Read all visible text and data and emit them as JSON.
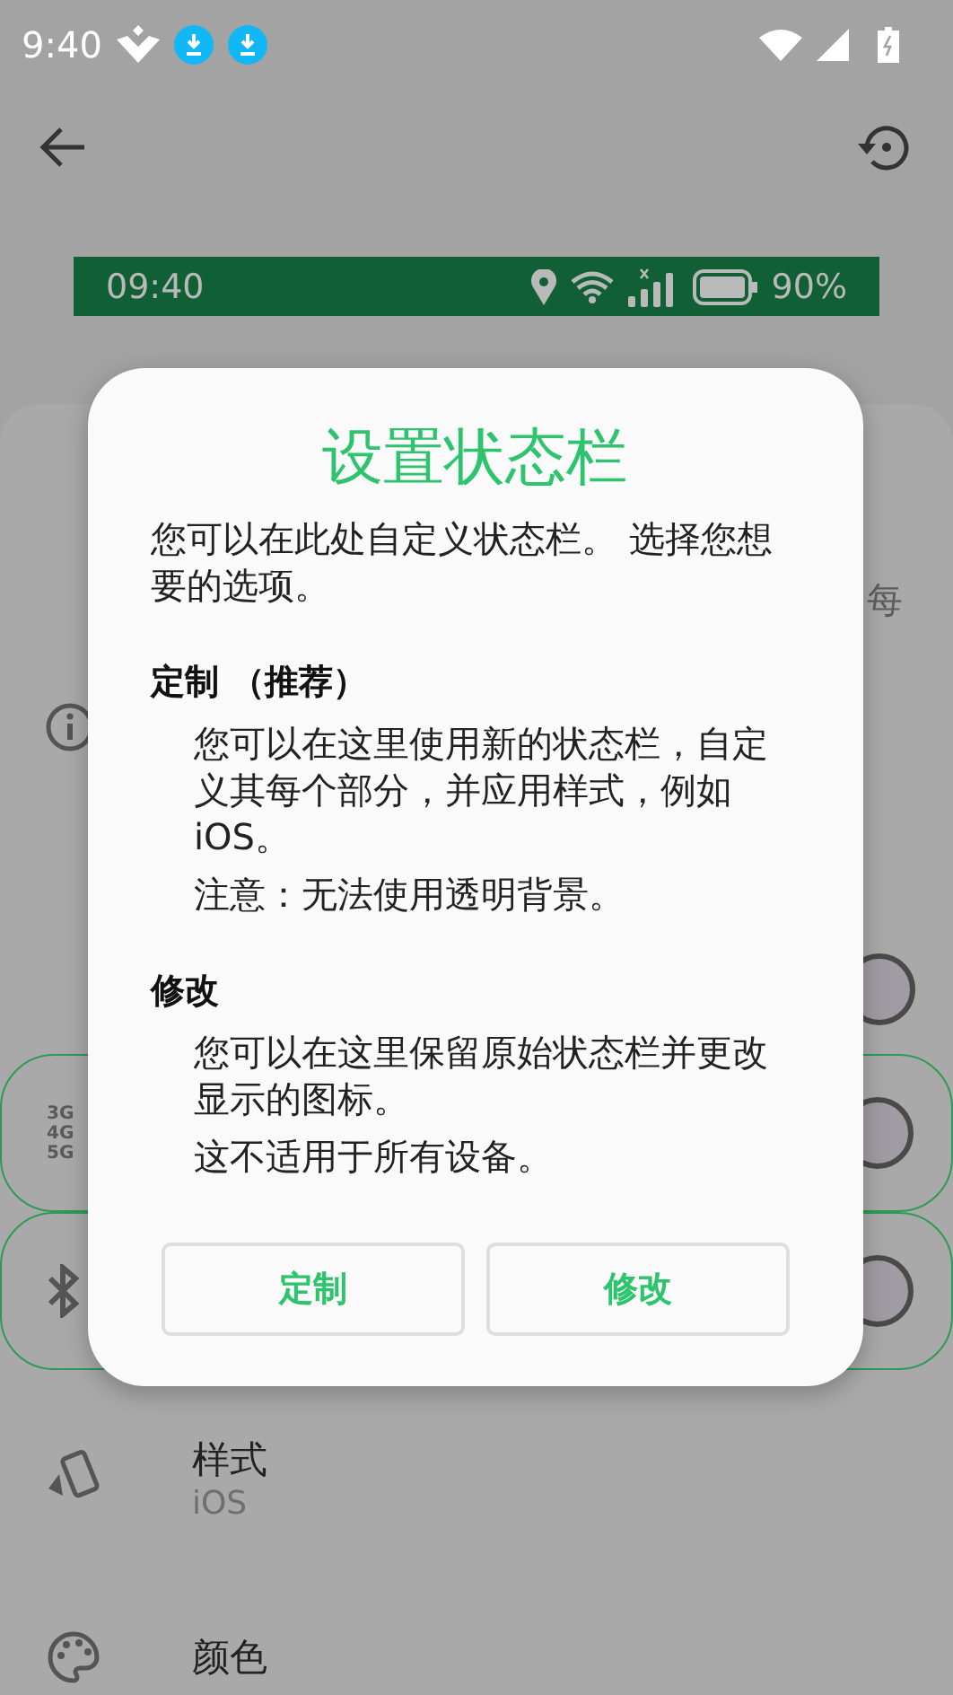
{
  "status_bar": {
    "time": "9:40"
  },
  "preview_bar": {
    "time": "09:40",
    "battery": "90%"
  },
  "settings": {
    "partial_text": "每",
    "network_labels": [
      "3G",
      "4G",
      "5G"
    ]
  },
  "list_items": [
    {
      "kind": "style",
      "title": "样式",
      "subtitle": "iOS"
    },
    {
      "kind": "color",
      "title": "颜色"
    }
  ],
  "dialog": {
    "title": "设置状态栏",
    "intro": "您可以在此处自定义状态栏。 选择您想要的选项。",
    "sections": [
      {
        "heading": "定制 （推荐）",
        "body": "您可以在这里使用新的状态栏，自定义其每个部分，并应用样式，例如iOS。",
        "note": "注意：无法使用透明背景。"
      },
      {
        "heading": "修改",
        "body": "您可以在这里保留原始状态栏并更改显示的图标。",
        "note": "这不适用于所有设备。"
      }
    ],
    "buttons": [
      "定制",
      "修改"
    ]
  }
}
